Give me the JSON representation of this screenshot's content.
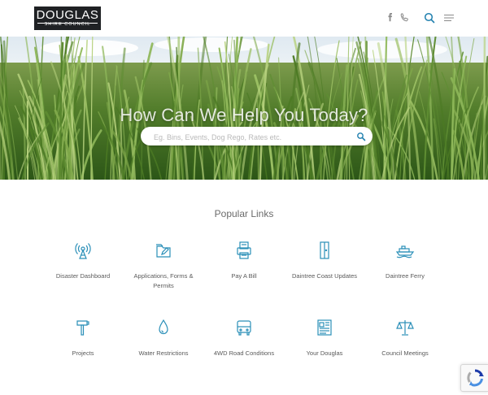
{
  "header": {
    "logo_line1": "DOUGLAS",
    "logo_line2": "SHIRE COUNCIL",
    "icons": [
      "facebook-icon",
      "phone-icon",
      "search-icon",
      "menu-icon"
    ]
  },
  "hero": {
    "title": "How Can We Help You Today?",
    "search_placeholder": "Eg. Bins, Events, Dog Rego, Rates etc."
  },
  "popular": {
    "title": "Popular Links",
    "items": [
      {
        "label": "Disaster Dashboard",
        "icon": "radio-tower-icon"
      },
      {
        "label": "Applications, Forms & Permits",
        "icon": "forms-icon"
      },
      {
        "label": "Pay A Bill",
        "icon": "bill-icon"
      },
      {
        "label": "Daintree Coast Updates",
        "icon": "door-icon"
      },
      {
        "label": "Daintree Ferry",
        "icon": "ferry-icon"
      },
      {
        "label": "Projects",
        "icon": "hammer-icon"
      },
      {
        "label": "Water Restrictions",
        "icon": "water-drop-icon"
      },
      {
        "label": "4WD Road Conditions",
        "icon": "vehicle-icon"
      },
      {
        "label": "Your Douglas",
        "icon": "newspaper-icon"
      },
      {
        "label": "Council Meetings",
        "icon": "scales-icon"
      }
    ]
  },
  "colors": {
    "accent": "#2a8fb8",
    "icon": "#2a8fb8",
    "logo_bg": "#1f2124"
  }
}
